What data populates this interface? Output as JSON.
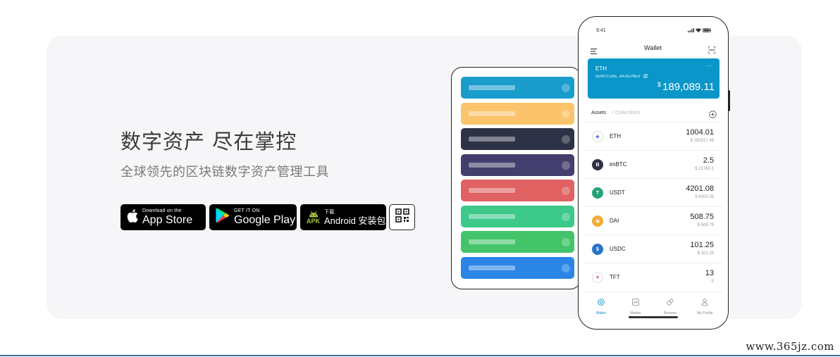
{
  "hero": {
    "headline": "数字资产 尽在掌控",
    "subline": "全球领先的区块链数字资产管理工具"
  },
  "buttons": {
    "app_store_small": "Download on the",
    "app_store_big": "App Store",
    "google_small": "GET IT ON",
    "google_big": "Google Play",
    "apk_small": "下载",
    "apk_badge": "APK",
    "apk_big": "Android 安装包"
  },
  "card_stack": {
    "colors": [
      "#1a9ccc",
      "#fbc46c",
      "#2e3246",
      "#433e6d",
      "#e06262",
      "#3cc98a",
      "#43c46a",
      "#2a85e6"
    ]
  },
  "phone": {
    "time": "9:41",
    "title": "Wallet",
    "eth_card": {
      "name": "ETH",
      "address": "0x08711d3b...8418a7f8e3",
      "more": "···",
      "currency": "$",
      "balance": "189,089.11",
      "color": "#0a96c9"
    },
    "tabs": {
      "assets": "Assets",
      "collectibles": "/ Collectibles"
    },
    "assets": [
      {
        "name": "ETH",
        "amount": "1004.01",
        "value": "$ 162517.48",
        "icon": "eth-icon",
        "color": "#ffffff",
        "glyph": "◆"
      },
      {
        "name": "imBTC",
        "amount": "2.5",
        "value": "$ 21760.1",
        "icon": "imbtc-icon",
        "color": "#2e3246",
        "glyph": "B"
      },
      {
        "name": "USDT",
        "amount": "4201.08",
        "value": "$ 4201.08",
        "icon": "usdt-icon",
        "color": "#26a17b",
        "glyph": "T"
      },
      {
        "name": "DAI",
        "amount": "508.75",
        "value": "$ 508.75",
        "icon": "dai-icon",
        "color": "#f5ac37",
        "glyph": "◉"
      },
      {
        "name": "USDC",
        "amount": "101.25",
        "value": "$ 101.25",
        "icon": "usdc-icon",
        "color": "#2775ca",
        "glyph": "$"
      },
      {
        "name": "TFT",
        "amount": "13",
        "value": "0",
        "icon": "tft-icon",
        "color": "#ffffff",
        "glyph": "♥"
      }
    ],
    "tabbar": [
      {
        "label": "Wallet",
        "icon": "wallet-icon"
      },
      {
        "label": "Market",
        "icon": "market-icon"
      },
      {
        "label": "Browser",
        "icon": "browser-icon"
      },
      {
        "label": "My Profile",
        "icon": "profile-icon"
      }
    ]
  },
  "watermark": "www.365jz.com"
}
